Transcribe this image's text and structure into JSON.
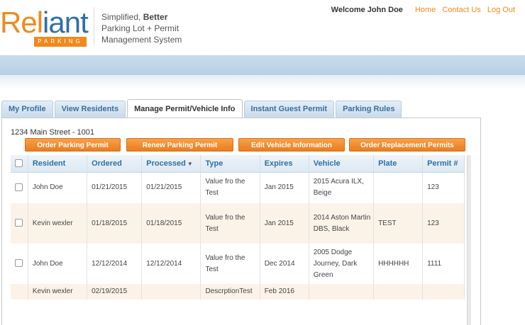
{
  "header": {
    "logo": {
      "word_main": "Rel",
      "word_accent": "iant",
      "sub": "PARKING"
    },
    "tagline_line1_prefix": "Simplified, ",
    "tagline_line1_bold": "Better",
    "tagline_line2": "Parking Lot + Permit",
    "tagline_line3": "Management System",
    "welcome": "Welcome John Doe",
    "links": {
      "home": "Home",
      "contact": "Contact Us",
      "logout": "Log Out"
    }
  },
  "tabs": [
    {
      "label": "My Profile",
      "active": false
    },
    {
      "label": "View Residents",
      "active": false
    },
    {
      "label": "Manage Permit/Vehicle Info",
      "active": true
    },
    {
      "label": "Instant Guest Permit",
      "active": false
    },
    {
      "label": "Parking Rules",
      "active": false
    }
  ],
  "address": "1234 Main Street - 1001",
  "actions": {
    "order": "Order Parking Permit",
    "renew": "Renew Parking Permit",
    "edit": "Edit Vehicle Information",
    "replace": "Order Replacement Permits"
  },
  "table": {
    "columns": [
      "Resident",
      "Ordered",
      "Processed",
      "Type",
      "Expires",
      "Vehicle",
      "Plate",
      "Permit #"
    ],
    "sort_indicator": "▼",
    "rows": [
      {
        "resident": "John Doe",
        "ordered": "01/21/2015",
        "processed": "01/21/2015",
        "type": "Value fro the Test",
        "expires": "Jan 2015",
        "vehicle": "2015 Acura ILX, Beige",
        "plate": "",
        "permit": "123"
      },
      {
        "resident": "Kevin wexler",
        "ordered": "01/18/2015",
        "processed": "01/18/2015",
        "type": "Value fro the Test",
        "expires": "Jan 2015",
        "vehicle": "2014 Aston Martin DBS, Black",
        "plate": "TEST",
        "permit": "123"
      },
      {
        "resident": "John Doe",
        "ordered": "12/12/2014",
        "processed": "12/12/2014",
        "type": "Value fro the Test",
        "expires": "Dec 2014",
        "vehicle": "2005 Dodge Journey, Dark Green",
        "plate": "HHHHHH",
        "permit": "1111"
      },
      {
        "resident": "Kevin wexler",
        "ordered": "02/19/2015",
        "processed": "",
        "type": "DescrptionTest",
        "expires": "Feb 2016",
        "vehicle": "",
        "plate": "",
        "permit": ""
      }
    ]
  },
  "colors": {
    "accent": "#f08a1c",
    "brand_blue": "#2f6fa6",
    "row_alt": "#fbf3e8"
  }
}
